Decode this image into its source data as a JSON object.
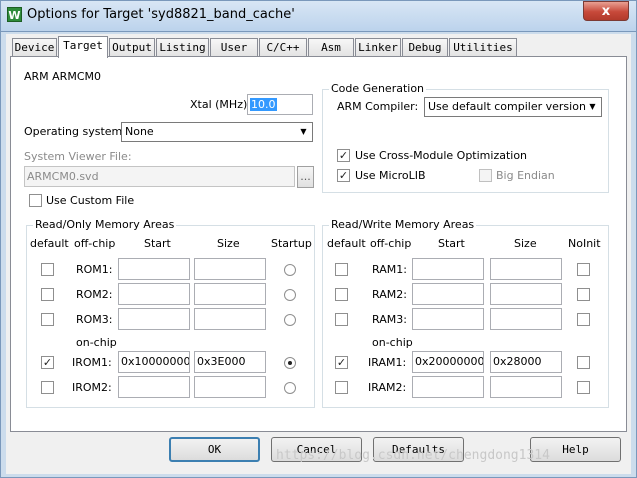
{
  "window": {
    "title": "Options for Target 'syd8821_band_cache'",
    "app_icon": "W",
    "close": "x"
  },
  "tabs": [
    "Device",
    "Target",
    "Output",
    "Listing",
    "User",
    "C/C++",
    "Asm",
    "Linker",
    "Debug",
    "Utilities"
  ],
  "active_tab": "Target",
  "target": {
    "device_name": "ARM ARMCM0",
    "xtal_label": "Xtal (MHz):",
    "xtal_value": "10.0",
    "os_label": "Operating system:",
    "os_value": "None",
    "svf_label": "System Viewer File:",
    "svf_value": "ARMCM0.svd",
    "svf_browse": "...",
    "use_custom_file": {
      "label": "Use Custom File",
      "checked": false
    }
  },
  "codegen": {
    "title": "Code Generation",
    "compiler_label": "ARM Compiler:",
    "compiler_value": "Use default compiler version",
    "cross_module": {
      "label": "Use Cross-Module Optimization",
      "checked": true
    },
    "microlib": {
      "label": "Use MicroLIB",
      "checked": true
    },
    "big_endian": {
      "label": "Big Endian",
      "checked": false,
      "disabled": true
    }
  },
  "rom_area": {
    "title": "Read/Only Memory Areas",
    "headers": {
      "default": "default",
      "offchip": "off-chip",
      "start": "Start",
      "size": "Size",
      "startup": "Startup"
    },
    "onchip_label": "on-chip",
    "rows": [
      {
        "name": "ROM1:",
        "default": false,
        "start": "",
        "size": "",
        "startup": false
      },
      {
        "name": "ROM2:",
        "default": false,
        "start": "",
        "size": "",
        "startup": false
      },
      {
        "name": "ROM3:",
        "default": false,
        "start": "",
        "size": "",
        "startup": false
      },
      {
        "name": "IROM1:",
        "default": true,
        "start": "0x10000000",
        "size": "0x3E000",
        "startup": true
      },
      {
        "name": "IROM2:",
        "default": false,
        "start": "",
        "size": "",
        "startup": false
      }
    ]
  },
  "ram_area": {
    "title": "Read/Write Memory Areas",
    "headers": {
      "default": "default",
      "offchip": "off-chip",
      "start": "Start",
      "size": "Size",
      "noinit": "NoInit"
    },
    "onchip_label": "on-chip",
    "rows": [
      {
        "name": "RAM1:",
        "default": false,
        "start": "",
        "size": "",
        "noinit": false
      },
      {
        "name": "RAM2:",
        "default": false,
        "start": "",
        "size": "",
        "noinit": false
      },
      {
        "name": "RAM3:",
        "default": false,
        "start": "",
        "size": "",
        "noinit": false
      },
      {
        "name": "IRAM1:",
        "default": true,
        "start": "0x20000000",
        "size": "0x28000",
        "noinit": false
      },
      {
        "name": "IRAM2:",
        "default": false,
        "start": "",
        "size": "",
        "noinit": false
      }
    ]
  },
  "buttons": {
    "ok": "OK",
    "cancel": "Cancel",
    "defaults": "Defaults",
    "help": "Help"
  },
  "watermark": "https://blog.csdn.net/chengdong1314"
}
